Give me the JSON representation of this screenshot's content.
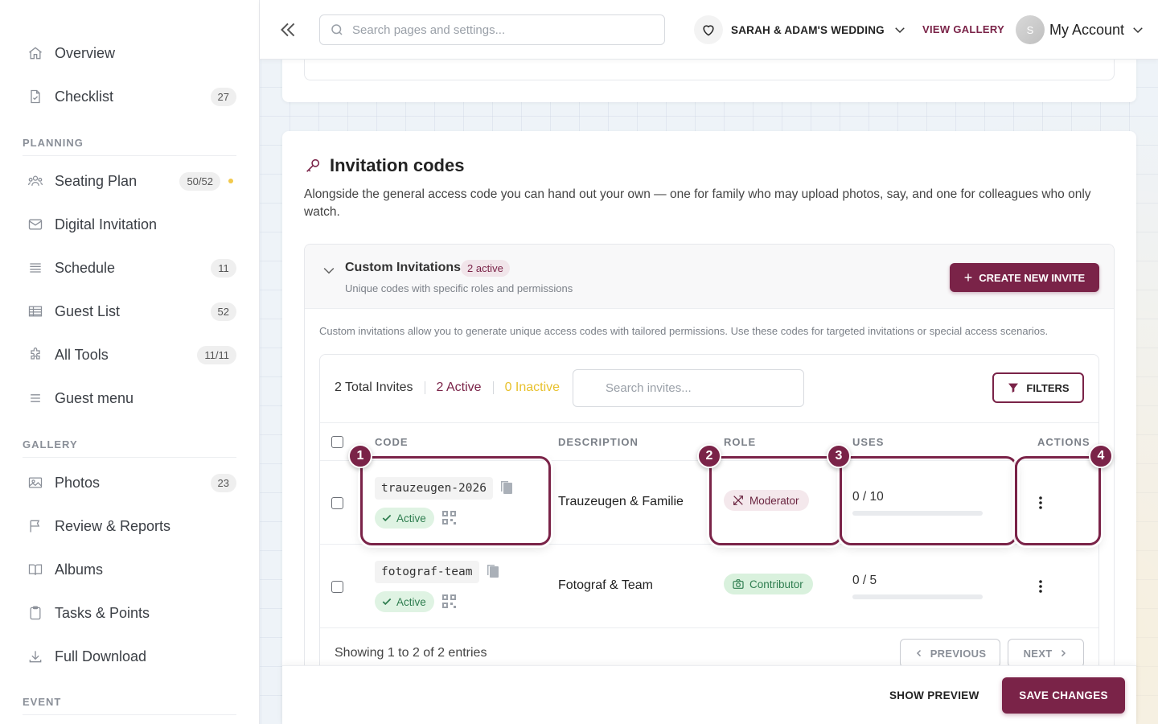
{
  "sidebar": {
    "items": [
      {
        "label": "Overview",
        "badge": ""
      },
      {
        "label": "Checklist",
        "badge": "27"
      },
      {
        "label": "Seating Plan",
        "badge": "50/52"
      },
      {
        "label": "Digital Invitation",
        "badge": ""
      },
      {
        "label": "Schedule",
        "badge": "11"
      },
      {
        "label": "Guest List",
        "badge": "52"
      },
      {
        "label": "All Tools",
        "badge": "11/11"
      },
      {
        "label": "Guest menu",
        "badge": ""
      },
      {
        "label": "Photos",
        "badge": "23"
      },
      {
        "label": "Review & Reports",
        "badge": ""
      },
      {
        "label": "Albums",
        "badge": ""
      },
      {
        "label": "Tasks & Points",
        "badge": ""
      },
      {
        "label": "Full Download",
        "badge": ""
      }
    ],
    "sections": {
      "planning": "PLANNING",
      "gallery": "GALLERY",
      "event": "EVENT"
    }
  },
  "topbar": {
    "search_placeholder": "Search pages and settings...",
    "event_name": "SARAH & ADAM'S WEDDING",
    "view_gallery": "VIEW GALLERY",
    "avatar_initial": "S",
    "account_label": "My Account"
  },
  "invitation_codes": {
    "title": "Invitation codes",
    "description": "Alongside the general access code you can hand out your own — one for family who may upload photos, say, and one for colleagues who only watch.",
    "panel": {
      "title": "Custom Invitations",
      "active_badge": "2 active",
      "subtitle": "Unique codes with specific roles and permissions",
      "create_button": "CREATE NEW INVITE",
      "info": "Custom invitations allow you to generate unique access codes with tailored permissions. Use these codes for targeted invitations or special access scenarios."
    },
    "table": {
      "stats": {
        "total": "2 Total Invites",
        "active": "2 Active",
        "inactive": "0 Inactive"
      },
      "search_placeholder": "Search invites...",
      "filters_button": "FILTERS",
      "columns": {
        "code": "CODE",
        "description": "DESCRIPTION",
        "role": "ROLE",
        "uses": "USES",
        "actions": "ACTIONS"
      },
      "rows": [
        {
          "code": "trauzeugen-2026",
          "status": "Active",
          "description": "Trauzeugen & Familie",
          "role": "Moderator",
          "uses": "0 / 10",
          "uses_fraction": 0
        },
        {
          "code": "fotograf-team",
          "status": "Active",
          "description": "Fotograf & Team",
          "role": "Contributor",
          "uses": "0 / 5",
          "uses_fraction": 0
        }
      ],
      "footer": "Showing 1 to 2 of 2 entries",
      "previous": "PREVIOUS",
      "next": "NEXT"
    },
    "callouts": [
      "1",
      "2",
      "3",
      "4"
    ]
  },
  "actions": {
    "preview": "SHOW PREVIEW",
    "save": "SAVE CHANGES"
  },
  "colors": {
    "accent": "#7a2348",
    "active_green": "#2e7d4f",
    "inactive_yellow": "#e8c12d"
  }
}
